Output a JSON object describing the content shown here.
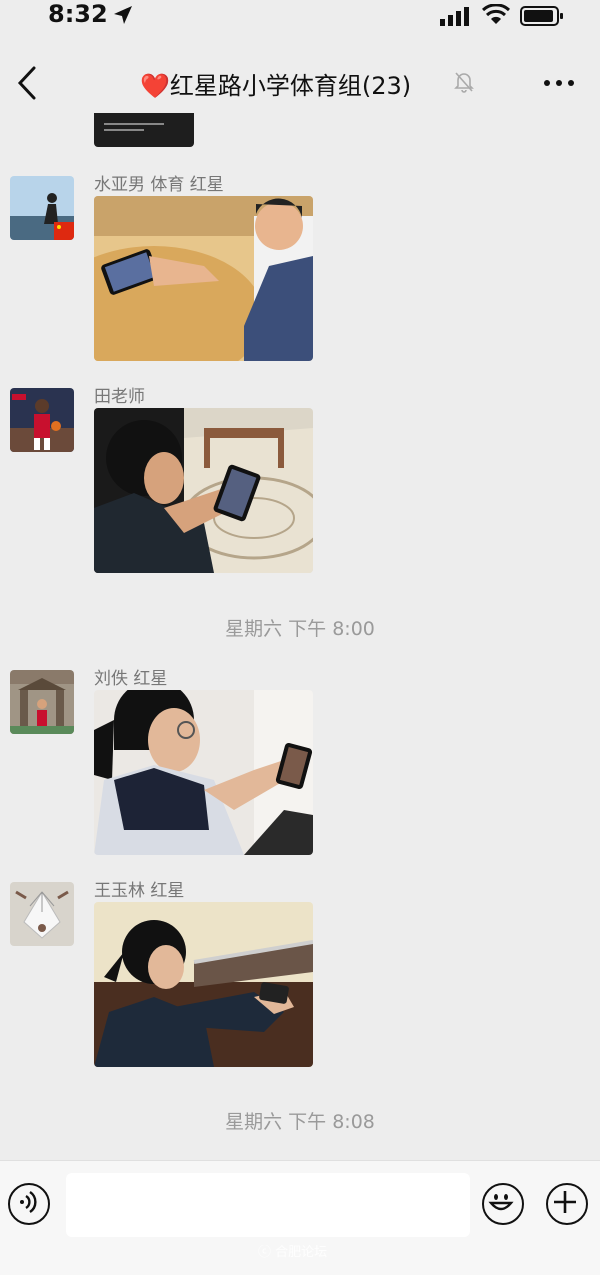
{
  "status": {
    "time": "8:32"
  },
  "header": {
    "title": "红星路小学体育组(23)",
    "heart": "❤️",
    "icons": {
      "back": "chevron-left-icon",
      "mute": "bell-slash-icon",
      "more": "ellipsis-icon"
    }
  },
  "messages": [
    {
      "sender": "水亚男 体育 红星",
      "content": "photo"
    },
    {
      "sender": "田老师",
      "content": "photo"
    },
    {
      "sender": "刘佚 红星",
      "content": "photo"
    },
    {
      "sender": "王玉林 红星",
      "content": "photo"
    }
  ],
  "time_separators": [
    "星期六 下午 8:00",
    "星期六 下午 8:08"
  ],
  "input_bar": {
    "icons": {
      "voice": "voice-icon",
      "emoji": "emoji-icon",
      "plus": "plus-icon"
    }
  },
  "watermark": "ⓒ 合肥论坛",
  "colors": {
    "background": "#ededed",
    "heart": "#e02020",
    "input_bar": "#f7f7f7"
  }
}
